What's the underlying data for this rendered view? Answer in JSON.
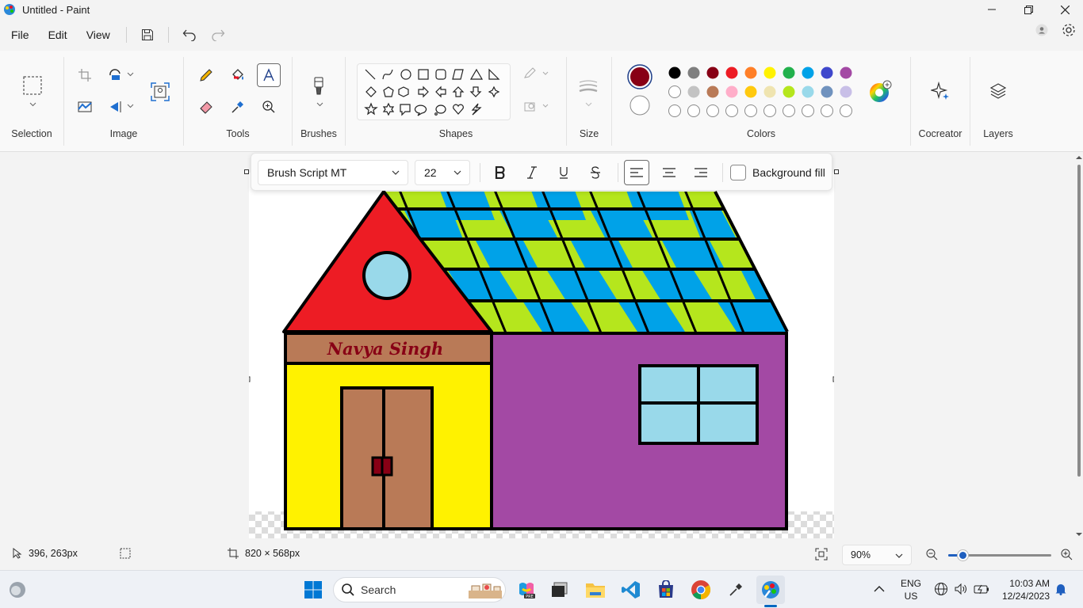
{
  "window": {
    "title": "Untitled - Paint"
  },
  "menu": {
    "file": "File",
    "edit": "Edit",
    "view": "View"
  },
  "ribbon": {
    "groups": {
      "selection": "Selection",
      "image": "Image",
      "tools": "Tools",
      "brushes": "Brushes",
      "shapes": "Shapes",
      "size": "Size",
      "colors": "Colors",
      "cocreator": "Cocreator",
      "layers": "Layers"
    },
    "primary_color": "#880015",
    "secondary_color": "#ffffff",
    "palette_row1": [
      "#000000",
      "#7f7f7f",
      "#880015",
      "#ed1c24",
      "#ff7f27",
      "#fff200",
      "#22b14c",
      "#00a2e8",
      "#3f48cc",
      "#a349a4"
    ],
    "palette_row2": [
      "#ffffff",
      "#c3c3c3",
      "#b97a57",
      "#ffaec9",
      "#ffc90e",
      "#efe4b0",
      "#b5e61d",
      "#99d9ea",
      "#7092be",
      "#c8bfe7"
    ]
  },
  "text_toolbar": {
    "font": "Brush Script MT",
    "size": "22",
    "background_fill": "Background fill"
  },
  "canvas": {
    "sign_text": "Navya Singh"
  },
  "status": {
    "cursor_position": "396, 263px",
    "canvas_size": "820 × 568px",
    "zoom": "90%"
  },
  "taskbar": {
    "search_placeholder": "Search",
    "language_top": "ENG",
    "language_bottom": "US",
    "time": "10:03 AM",
    "date": "12/24/2023"
  }
}
